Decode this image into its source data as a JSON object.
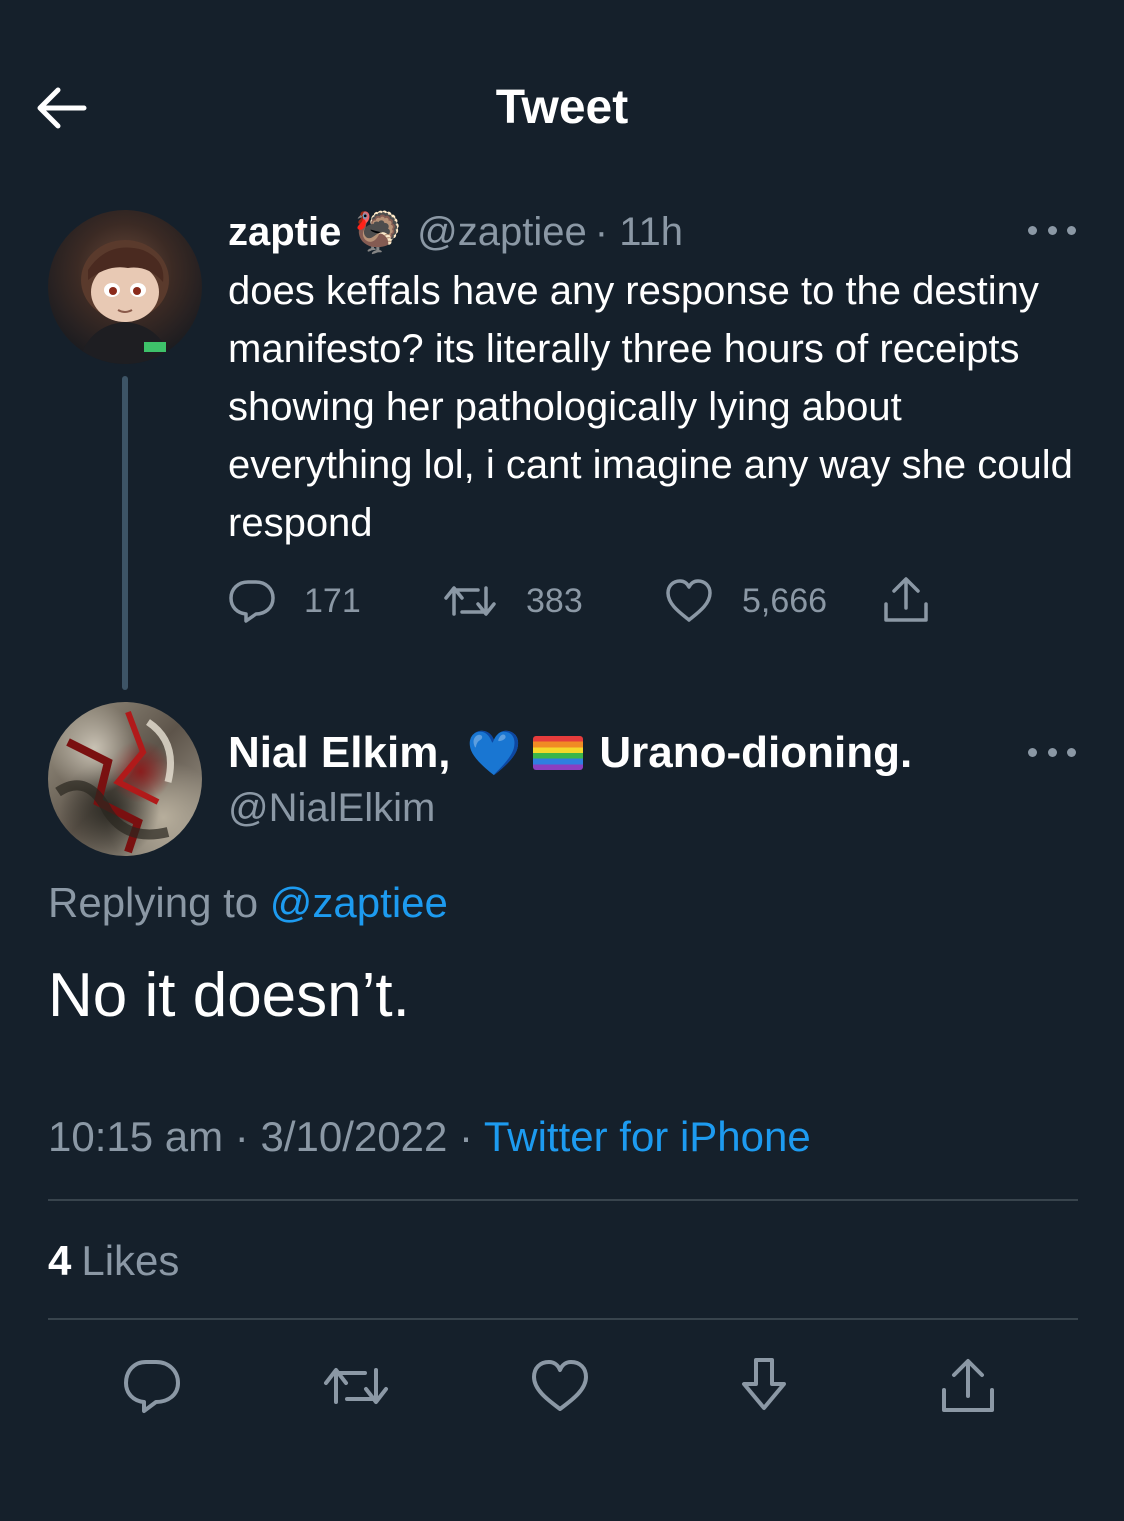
{
  "header": {
    "title": "Tweet"
  },
  "parent_tweet": {
    "display_name": "zaptie",
    "name_emoji": "🦃",
    "handle": "@zaptiee",
    "time": "· 11h",
    "text": "does keffals have any response to the destiny manifesto? its literally three hours of receipts showing her pathologically lying about everything lol, i cant imagine any way she could respond",
    "replies": "171",
    "retweets": "383",
    "likes": "5,666"
  },
  "main_tweet": {
    "display_name_prefix": "Nial Elkim,",
    "display_name_emoji": "💙",
    "display_name_suffix": "Urano-dioning.",
    "handle": "@NialElkim",
    "replying_label": "Replying to",
    "replying_to": "@zaptiee",
    "text": "No it doesn’t.",
    "time": "10:15 am",
    "date": "3/10/2022",
    "source": "Twitter for iPhone",
    "separator": "·",
    "like_count": "4",
    "like_label": "Likes"
  },
  "colors": {
    "background": "#15202b",
    "text": "#ffffff",
    "secondary": "#8b98a5",
    "link": "#1d9bf0",
    "divider": "#38444d"
  },
  "icons": [
    "back-arrow-icon",
    "more-icon",
    "reply-icon",
    "retweet-icon",
    "like-icon",
    "share-icon",
    "bookmark-icon"
  ]
}
